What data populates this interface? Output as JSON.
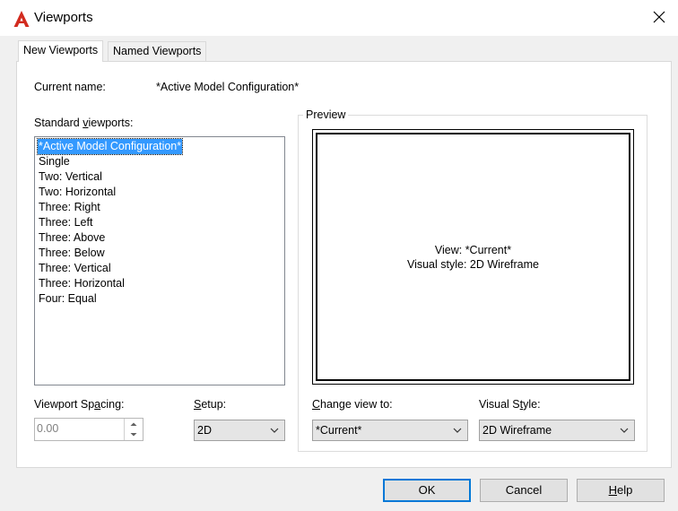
{
  "window": {
    "title": "Viewports"
  },
  "tabs": [
    {
      "label": "New Viewports",
      "active": true
    },
    {
      "label": "Named Viewports",
      "active": false
    }
  ],
  "current_name": {
    "label": "Current name:",
    "value": "*Active Model Configuration*"
  },
  "standard_viewports": {
    "label_pre": "Standard ",
    "label_ul": "v",
    "label_post": "iewports:",
    "items": [
      "*Active Model Configuration*",
      "Single",
      "Two:  Vertical",
      "Two:  Horizontal",
      "Three: Right",
      "Three: Left",
      "Three: Above",
      "Three: Below",
      "Three: Vertical",
      "Three: Horizontal",
      "Four:  Equal"
    ],
    "selected_index": 0
  },
  "preview": {
    "group_title": "Preview",
    "view_text": "View: *Current*",
    "style_text": "Visual style: 2D Wireframe"
  },
  "viewport_spacing": {
    "label_pre": "Viewport Sp",
    "label_ul": "a",
    "label_post": "cing:",
    "value": "0.00"
  },
  "setup": {
    "label_pre": "",
    "label_ul": "S",
    "label_post": "etup:",
    "value": "2D"
  },
  "change_view": {
    "label_pre": "",
    "label_ul": "C",
    "label_post": "hange view to:",
    "value": "*Current*"
  },
  "visual_style": {
    "label_pre": "Visual S",
    "label_ul": "t",
    "label_post": "yle:",
    "value": "2D Wireframe"
  },
  "buttons": {
    "ok": "OK",
    "cancel": "Cancel",
    "help_ul": "H",
    "help_post": "elp"
  },
  "colors": {
    "selection": "#3399ff",
    "default_button_border": "#0078d7",
    "app_icon": "#d22b1f"
  }
}
